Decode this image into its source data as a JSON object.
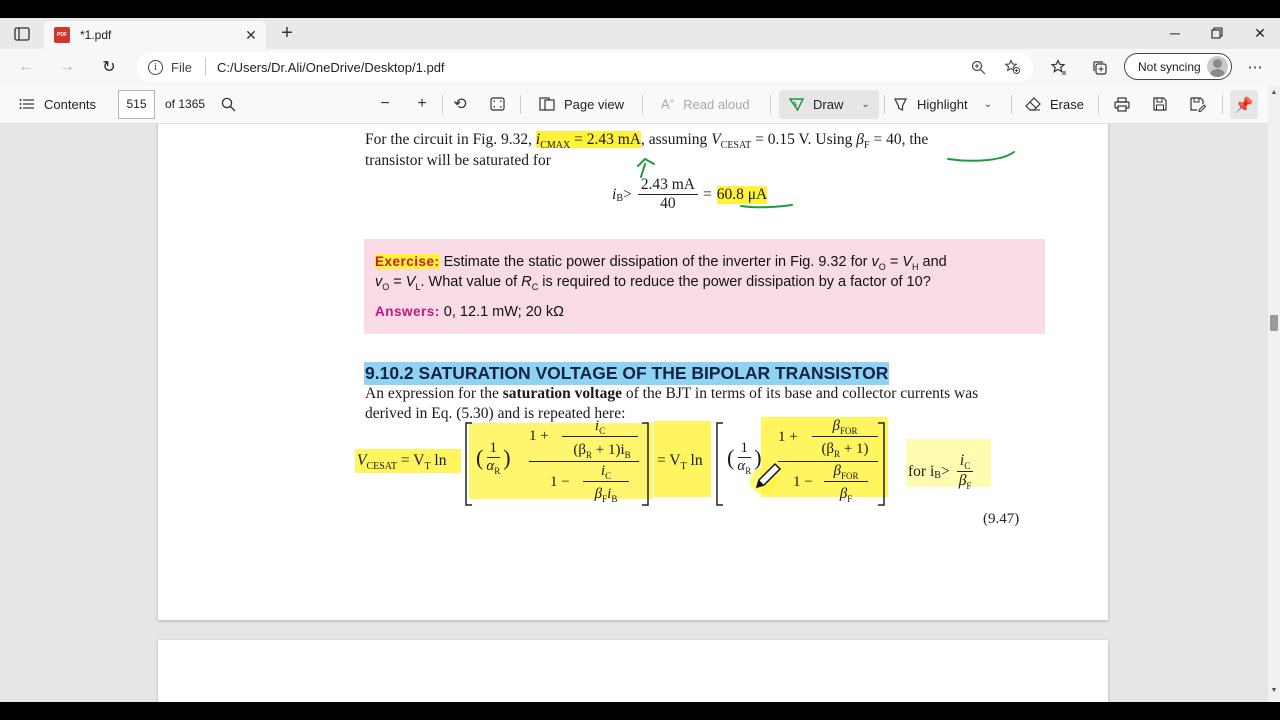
{
  "browser": {
    "tab": {
      "title": "*1.pdf",
      "badge": "PDF"
    },
    "address": {
      "scheme": "File",
      "url": "C:/Users/Dr.Ali/OneDrive/Desktop/1.pdf"
    },
    "profile": {
      "sync_label": "Not syncing"
    }
  },
  "pdf_toolbar": {
    "contents_label": "Contents",
    "page_current": "515",
    "page_total": "of 1365",
    "page_view_label": "Page view",
    "read_aloud_label": "Read aloud",
    "draw_label": "Draw",
    "highlight_label": "Highlight",
    "erase_label": "Erase",
    "draw_color": "#1f9a3c"
  },
  "document": {
    "intro_line1_a": "For the circuit in Fig. 9.32, ",
    "intro_icmax": "i",
    "intro_icmax_sub": "CMAX",
    "intro_icmax_val": " = 2.43 mA",
    "intro_line1_b": ", assuming ",
    "intro_vcesat": "V",
    "intro_vcesat_sub": "CESAT",
    "intro_line1_c": " = 0.15 V. Using ",
    "intro_beta": "β",
    "intro_beta_sub": "F",
    "intro_line1_d": " = 40, the",
    "intro_line2": "transistor will be saturated for",
    "ib_lhs": "i",
    "ib_sub": "B",
    "ib_gt": " >",
    "ib_num": "2.43 mA",
    "ib_den": "40",
    "ib_eq": "=",
    "ib_result": "60.8 μA",
    "exercise": {
      "label": "Exercise:",
      "line1": " Estimate the static power dissipation of the inverter in Fig. 9.32 for ",
      "v1": "v",
      "v1_sub": "O",
      "eq1": " = ",
      "v2": "V",
      "v2_sub": "H",
      "line1_end": " and",
      "v3": "v",
      "v3_sub": "O",
      "eq2": " = ",
      "v4": "V",
      "v4_sub": "L",
      "line2": ". What value of ",
      "rc": "R",
      "rc_sub": "C",
      "line2_end": " is required to reduce the power dissipation by a factor of 10?",
      "answers_label": "Answers:",
      "answers_text": " 0, 12.1 mW; 20 kΩ"
    },
    "section_title": "9.10.2  SATURATION VOLTAGE OF THE BIPOLAR TRANSISTOR",
    "para_line1_a": "An expression for the ",
    "para_bold": "saturation voltage",
    "para_line1_b": " of the BJT in terms of its base and collector currents was",
    "para_line2": "derived in Eq. (5.30) and is repeated here:",
    "equation": {
      "lhs": "V",
      "lhs_sub": "CESAT",
      "eq_vt": " = V",
      "vt_sub": "T",
      "ln": " ln",
      "one": "1",
      "alpha": "α",
      "alpha_sub": "R",
      "one_plus": "1 + ",
      "ic": "i",
      "ic_sub": "C",
      "beta_r_plus": "(β",
      "beta_r_sub": "R",
      "plus_one": " + 1)i",
      "ib_sub2": "B",
      "one_minus": "1 − ",
      "ic2": "i",
      "ic2_sub": "C",
      "bf_ib": "β",
      "bf_ib_sub": "F",
      "bf_ib_i": "i",
      "bf_ib_i_sub": "B",
      "mid_eq": "= V",
      "mid_sub": "T",
      "mid_ln": " ln",
      "bfor": "β",
      "bfor_sub": "FOR",
      "bfor2": "β",
      "bfor2_sub": "FOR",
      "br2": "(β",
      "br2_sub": "R",
      "br2_end": " + 1)",
      "bf2": "β",
      "bf2_sub": "F",
      "for_text": "for i",
      "for_sub": "B",
      "for_gt": " >",
      "cond_ic": "i",
      "cond_ic_sub": "C",
      "cond_bf": "β",
      "cond_bf_sub": "F",
      "number": "(9.47)"
    }
  }
}
